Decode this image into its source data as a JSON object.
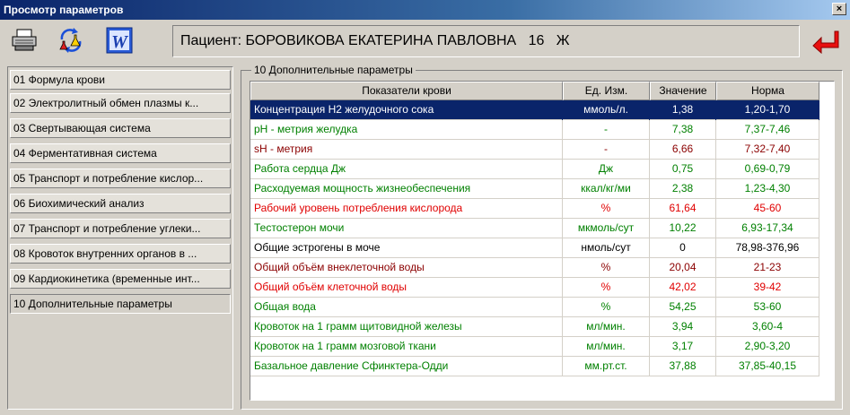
{
  "window": {
    "title": "Просмотр параметров",
    "close_label": "×"
  },
  "toolbar": {
    "icons": [
      "printer-icon",
      "refresh-flask-icon",
      "word-icon",
      "back-arrow-icon"
    ],
    "word_label": "W",
    "patient_label": "Пациент:",
    "patient_name": "БОРОВИКОВА ЕКАТЕРИНА ПАВЛОВНА",
    "patient_age": "16",
    "patient_sex": "Ж"
  },
  "sidebar": {
    "items": [
      {
        "label": "01 Формула крови"
      },
      {
        "label": "02 Электролитный обмен плазмы к..."
      },
      {
        "label": "03 Свертывающая система"
      },
      {
        "label": "04 Ферментативная система"
      },
      {
        "label": "05 Транспорт и потребление кислор..."
      },
      {
        "label": "06 Биохимический анализ"
      },
      {
        "label": "07 Транспорт и потребление углеки..."
      },
      {
        "label": "08 Кровоток внутренних органов в ..."
      },
      {
        "label": "09 Кардиокинетика (временные инт..."
      },
      {
        "label": "10 Дополнительные параметры",
        "active": true
      }
    ]
  },
  "group": {
    "title": "10 Дополнительные параметры"
  },
  "table": {
    "columns": [
      "Показатели крови",
      "Ед. Изм.",
      "Значение",
      "Норма"
    ],
    "rows": [
      {
        "name": "Концентрация Н2 желудочного сока",
        "unit": "ммоль/л.",
        "value": "1,38",
        "norm": "1,20-1,70",
        "color": "selected"
      },
      {
        "name": "pH - метрия желудка",
        "unit": "-",
        "value": "7,38",
        "norm": "7,37-7,46",
        "color": "green"
      },
      {
        "name": "sH - метрия",
        "unit": "-",
        "value": "6,66",
        "norm": "7,32-7,40",
        "color": "dkred"
      },
      {
        "name": "Работа сердца Дж",
        "unit": "Дж",
        "value": "0,75",
        "norm": "0,69-0,79",
        "color": "green"
      },
      {
        "name": "Расходуемая мощность жизнеобеспечения",
        "unit": "ккал/кг/ми",
        "value": "2,38",
        "norm": "1,23-4,30",
        "color": "green"
      },
      {
        "name": "Рабочий уровень потребления кислорода",
        "unit": "%",
        "value": "61,64",
        "norm": "45-60",
        "color": "red"
      },
      {
        "name": "Тестостерон мочи",
        "unit": "мкмоль/сут",
        "value": "10,22",
        "norm": "6,93-17,34",
        "color": "green"
      },
      {
        "name": "Общие эстрогены в моче",
        "unit": "нмоль/сут",
        "value": "0",
        "norm": "78,98-376,96",
        "color": "black"
      },
      {
        "name": "Общий объём внеклеточной воды",
        "unit": "%",
        "value": "20,04",
        "norm": "21-23",
        "color": "dkred"
      },
      {
        "name": "Общий объём клеточной воды",
        "unit": "%",
        "value": "42,02",
        "norm": "39-42",
        "color": "red"
      },
      {
        "name": "Общая вода",
        "unit": "%",
        "value": "54,25",
        "norm": "53-60",
        "color": "green"
      },
      {
        "name": "Кровоток на 1 грамм щитовидной железы",
        "unit": "мл/мин.",
        "value": "3,94",
        "norm": "3,60-4",
        "color": "green"
      },
      {
        "name": "Кровоток на 1 грамм мозговой ткани",
        "unit": "мл/мин.",
        "value": "3,17",
        "norm": "2,90-3,20",
        "color": "green"
      },
      {
        "name": "Базальное давление Сфинктера-Одди",
        "unit": "мм.рт.ст.",
        "value": "37,88",
        "norm": "37,85-40,15",
        "color": "green"
      }
    ]
  },
  "colors": {
    "selected": "#0a246a",
    "green": "#008000",
    "red": "#e00000",
    "dkred": "#8b0000"
  }
}
